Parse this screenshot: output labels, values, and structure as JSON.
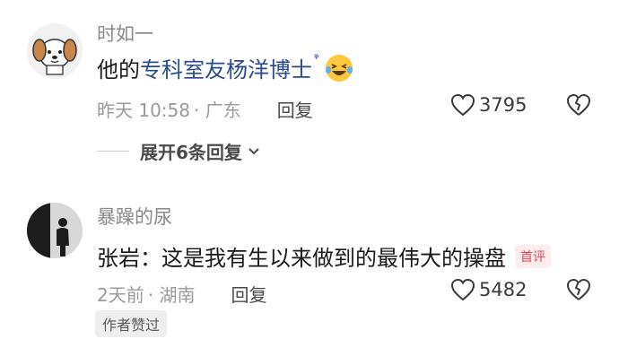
{
  "comments": [
    {
      "username": "时如一",
      "text_prefix": "他的",
      "text_link": "专科室友杨洋博士",
      "search_mark": "ᵠ",
      "emoji": "laughing-crying-emoji",
      "time": "昨天 10:58",
      "location": "· 广东",
      "reply_label": "回复",
      "like_count": "3795",
      "avatar": "puppy-avatar"
    },
    {
      "username": "暴躁的尿",
      "text": "张岩：这是我有生以来做到的最伟大的操盘",
      "badge": "首评",
      "time": "2天前",
      "location": "· 湖南",
      "reply_label": "回复",
      "like_count": "5482",
      "author_liked": "作者赞过",
      "avatar": "silhouette-avatar"
    }
  ],
  "expand_replies": "展开6条回复",
  "colors": {
    "link": "#2b4a8b",
    "meta": "#9a9a9a",
    "badge_text": "#e0455a",
    "badge_bg": "#fdecee"
  }
}
